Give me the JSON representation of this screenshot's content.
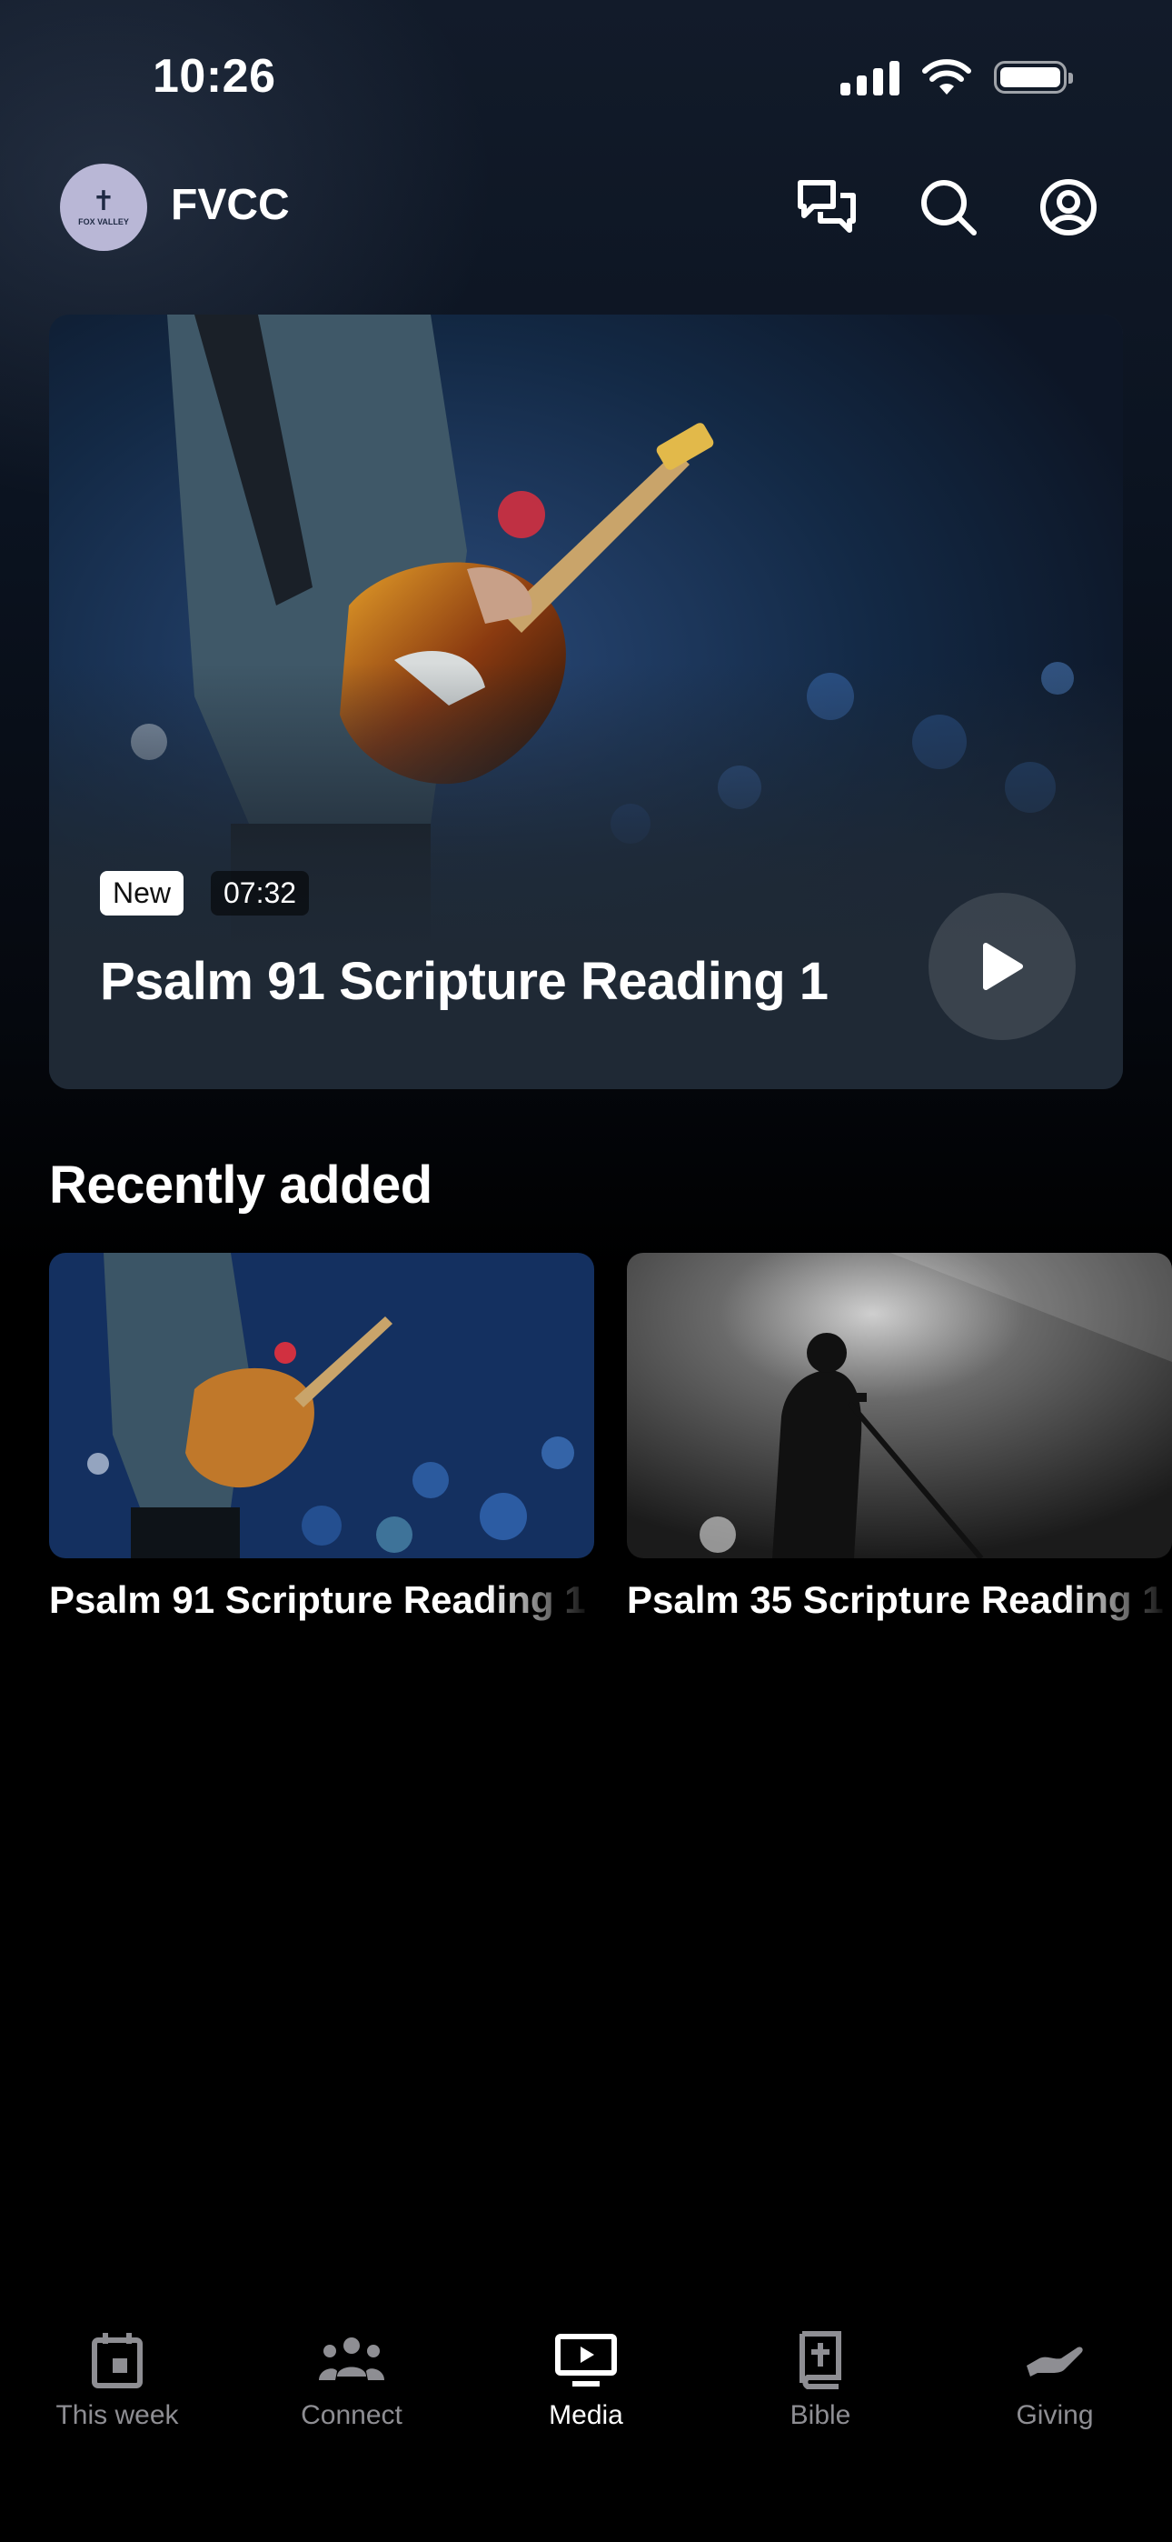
{
  "status_bar": {
    "time": "10:26"
  },
  "header": {
    "app_name": "FVCC",
    "avatar_text": "FOX VALLEY"
  },
  "featured": {
    "badge_new": "New",
    "duration": "07:32",
    "title": "Psalm 91 Scripture Reading 1"
  },
  "recently_added": {
    "title": "Recently added",
    "items": [
      {
        "title": "Psalm 91 Scripture Reading 1"
      },
      {
        "title": "Psalm 35 Scripture Reading 1"
      }
    ]
  },
  "tabbar": {
    "tabs": [
      {
        "label": "This week",
        "icon": "calendar-icon"
      },
      {
        "label": "Connect",
        "icon": "people-icon"
      },
      {
        "label": "Media",
        "icon": "tv-play-icon",
        "active": true
      },
      {
        "label": "Bible",
        "icon": "bible-icon"
      },
      {
        "label": "Giving",
        "icon": "giving-hand-icon"
      }
    ]
  },
  "colors": {
    "background": "#000000",
    "card": "#1f2935",
    "inactive_tab": "#8e8e93",
    "avatar": "#b9b7d6"
  }
}
